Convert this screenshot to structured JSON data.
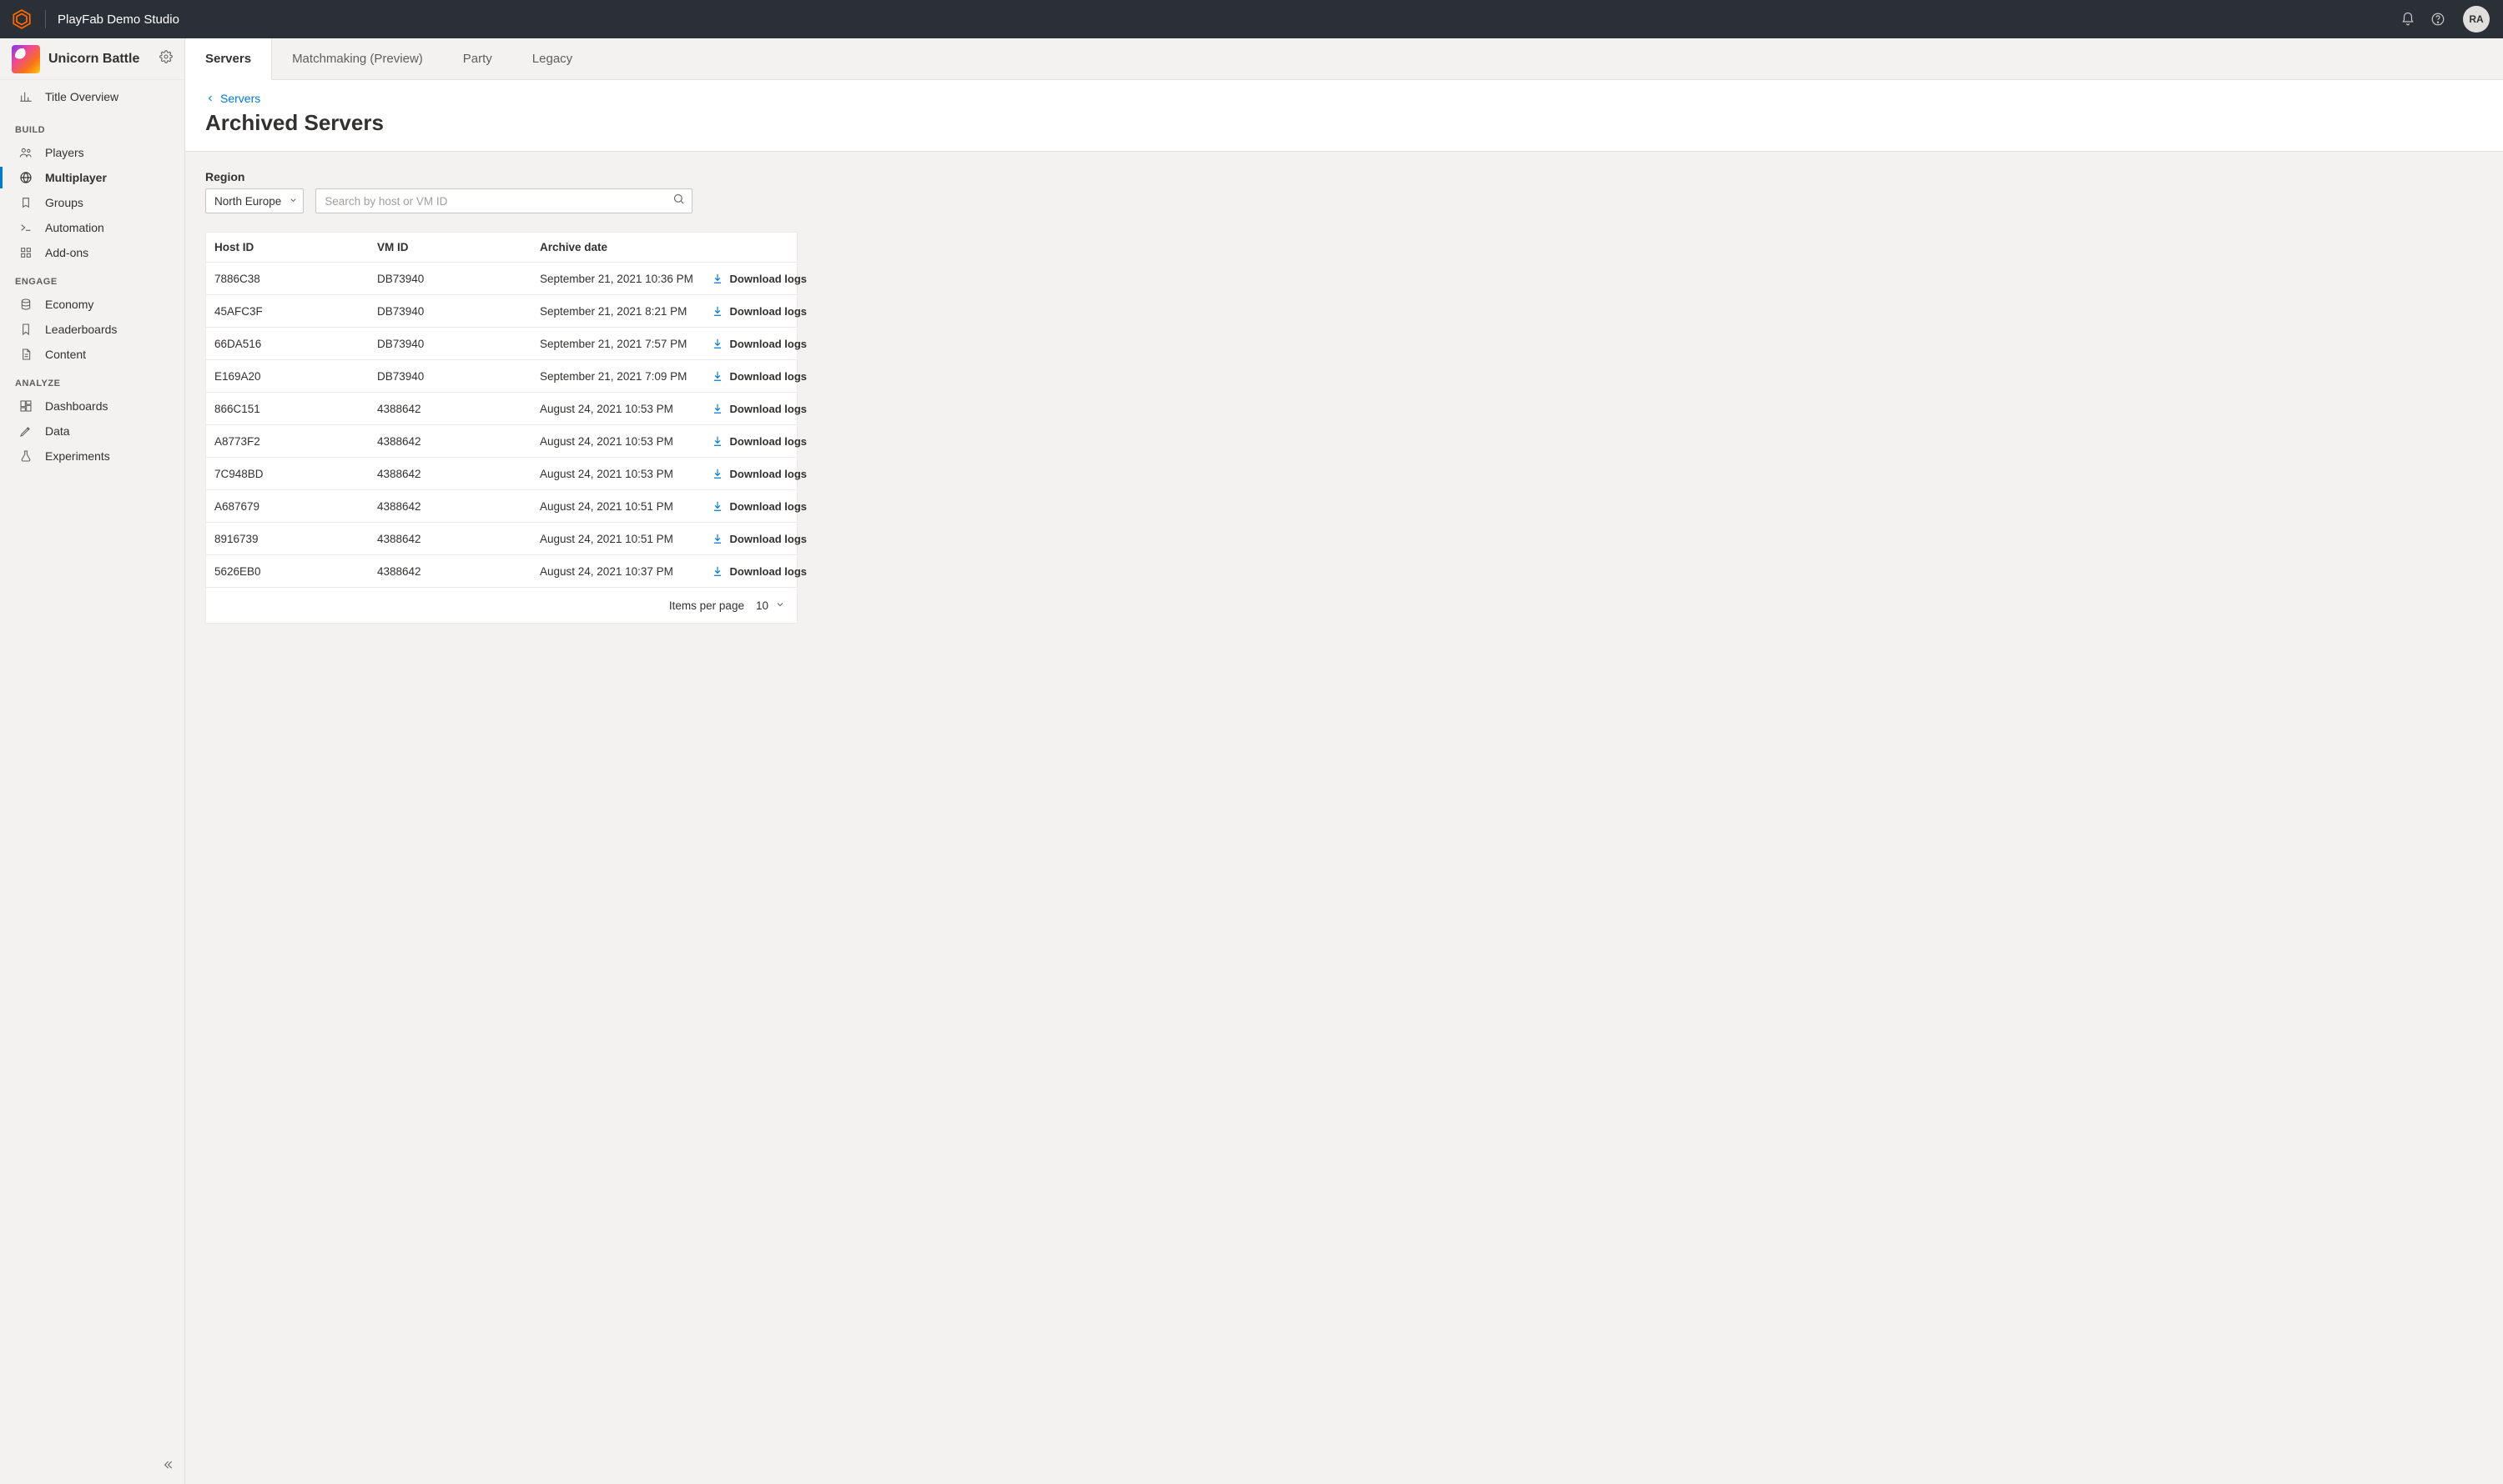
{
  "topbar": {
    "studio_name": "PlayFab Demo Studio",
    "avatar_initials": "RA"
  },
  "title": {
    "name": "Unicorn Battle"
  },
  "nav": {
    "overview": "Title Overview",
    "sections": {
      "build": {
        "label": "BUILD",
        "items": [
          {
            "label": "Players"
          },
          {
            "label": "Multiplayer"
          },
          {
            "label": "Groups"
          },
          {
            "label": "Automation"
          },
          {
            "label": "Add-ons"
          }
        ]
      },
      "engage": {
        "label": "ENGAGE",
        "items": [
          {
            "label": "Economy"
          },
          {
            "label": "Leaderboards"
          },
          {
            "label": "Content"
          }
        ]
      },
      "analyze": {
        "label": "ANALYZE",
        "items": [
          {
            "label": "Dashboards"
          },
          {
            "label": "Data"
          },
          {
            "label": "Experiments"
          }
        ]
      }
    }
  },
  "tabs": [
    {
      "label": "Servers",
      "active": true
    },
    {
      "label": "Matchmaking (Preview)"
    },
    {
      "label": "Party"
    },
    {
      "label": "Legacy"
    }
  ],
  "breadcrumb": {
    "back_label": "Servers"
  },
  "page": {
    "title": "Archived Servers"
  },
  "filters": {
    "region_label": "Region",
    "region_value": "North Europe",
    "search_placeholder": "Search by host or VM ID"
  },
  "table": {
    "columns": {
      "host": "Host ID",
      "vm": "VM ID",
      "date": "Archive date"
    },
    "download_label": "Download logs",
    "rows": [
      {
        "host": "7886C38",
        "vm": "DB73940",
        "date": "September 21, 2021 10:36 PM"
      },
      {
        "host": "45AFC3F",
        "vm": "DB73940",
        "date": "September 21, 2021 8:21 PM"
      },
      {
        "host": "66DA516",
        "vm": "DB73940",
        "date": "September 21, 2021 7:57 PM"
      },
      {
        "host": "E169A20",
        "vm": "DB73940",
        "date": "September 21, 2021 7:09 PM"
      },
      {
        "host": "866C151",
        "vm": "4388642",
        "date": "August 24, 2021 10:53 PM"
      },
      {
        "host": "A8773F2",
        "vm": "4388642",
        "date": "August 24, 2021 10:53 PM"
      },
      {
        "host": "7C948BD",
        "vm": "4388642",
        "date": "August 24, 2021 10:53 PM"
      },
      {
        "host": "A687679",
        "vm": "4388642",
        "date": "August 24, 2021 10:51 PM"
      },
      {
        "host": "8916739",
        "vm": "4388642",
        "date": "August 24, 2021 10:51 PM"
      },
      {
        "host": "5626EB0",
        "vm": "4388642",
        "date": "August 24, 2021 10:37 PM"
      }
    ],
    "pager": {
      "label": "Items per page",
      "value": "10"
    }
  }
}
